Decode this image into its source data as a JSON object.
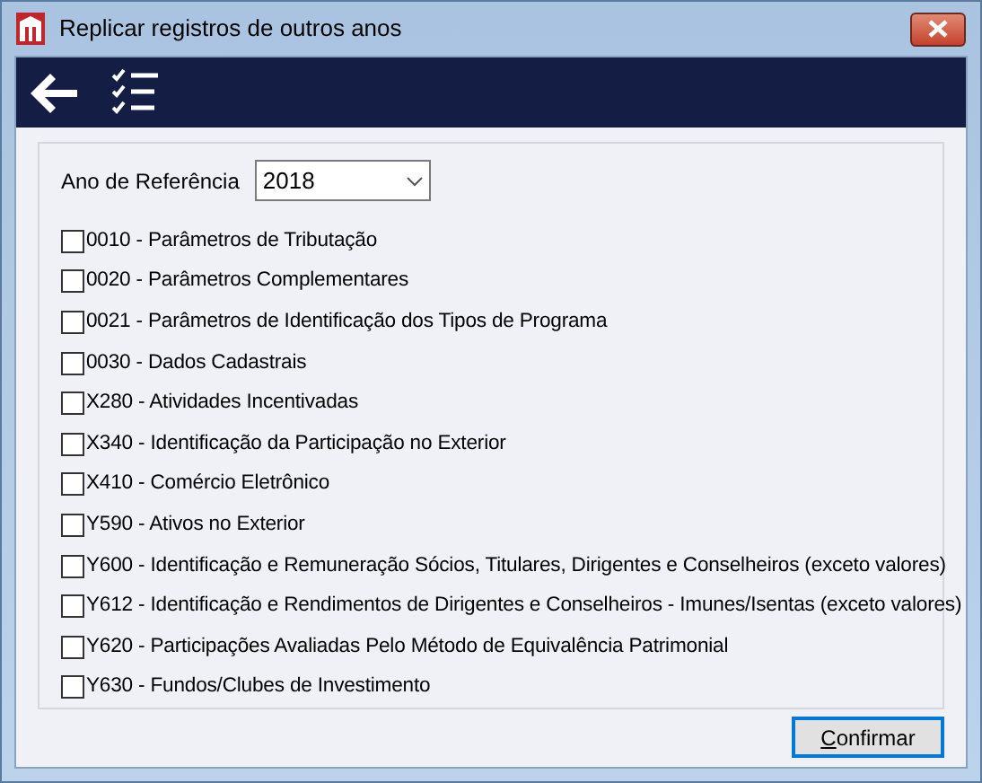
{
  "window": {
    "title": "Replicar registros de outros anos"
  },
  "reference_year": {
    "label": "Ano de Referência",
    "value": "2018"
  },
  "records": [
    {
      "label": "0010 - Parâmetros de Tributação",
      "checked": false
    },
    {
      "label": "0020 - Parâmetros Complementares",
      "checked": false
    },
    {
      "label": "0021 - Parâmetros de Identificação dos Tipos de Programa",
      "checked": false
    },
    {
      "label": "0030 - Dados Cadastrais",
      "checked": false
    },
    {
      "label": "X280 - Atividades Incentivadas",
      "checked": false
    },
    {
      "label": "X340 - Identificação da Participação no Exterior",
      "checked": false
    },
    {
      "label": "X410 - Comércio Eletrônico",
      "checked": false
    },
    {
      "label": "Y590 - Ativos no Exterior",
      "checked": false
    },
    {
      "label": "Y600 - Identificação e Remuneração Sócios, Titulares, Dirigentes e Conselheiros (exceto valores)",
      "checked": false
    },
    {
      "label": "Y612 - Identificação e Rendimentos de Dirigentes e Conselheiros - Imunes/Isentas (exceto valores)",
      "checked": false
    },
    {
      "label": "Y620 - Participações Avaliadas Pelo Método de Equivalência Patrimonial",
      "checked": false
    },
    {
      "label": "Y630 - Fundos/Clubes de Investimento",
      "checked": false
    }
  ],
  "confirm_button": "Confirmar"
}
